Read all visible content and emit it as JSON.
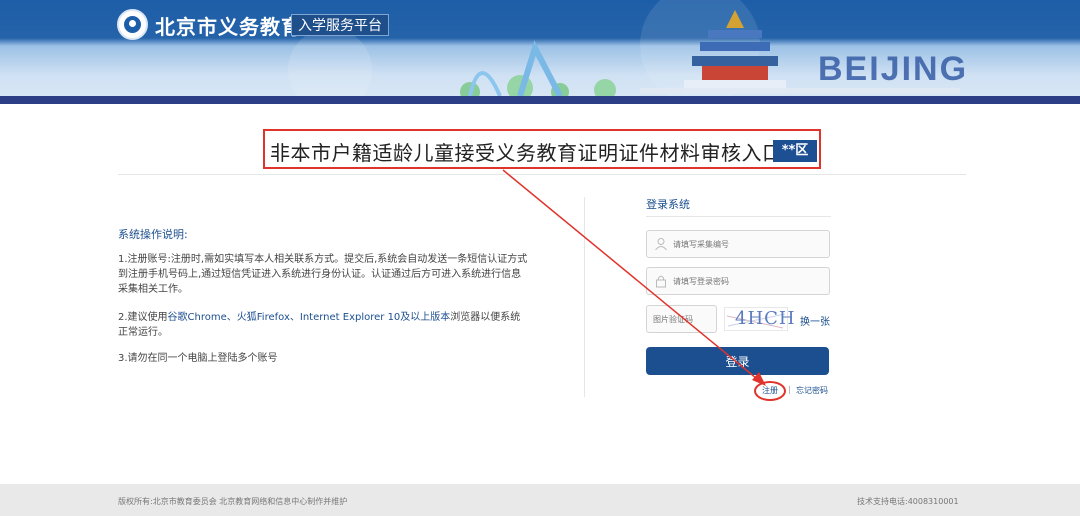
{
  "header": {
    "brand": "北京市义务教育",
    "badge": "入学服务平台",
    "banner_text": "BEIJING"
  },
  "main": {
    "title": "非本市户籍适龄儿童接受义务教育证明证件材料审核入口",
    "district_badge": "**区"
  },
  "instructions": {
    "heading": "系统操作说明:",
    "p1": "1.注册账号:注册时,需如实填写本人相关联系方式。提交后,系统会自动发送一条短信认证方式到注册手机号码上,通过短信凭证进入系统进行身份认证。认证通过后方可进入系统进行信息采集相关工作。",
    "p2_prefix": "2.建议使用",
    "p2_browsers": "谷歌Chrome、火狐Firefox、Internet Explorer 10及以上版本",
    "p2_suffix": "浏览器以便系统正常运行。",
    "p3": "3.请勿在同一个电脑上登陆多个账号"
  },
  "login": {
    "title": "登录系统",
    "username_placeholder": "请填写采集编号",
    "password_placeholder": "请填写登录密码",
    "captcha_placeholder": "图片验证码",
    "captcha_code": "4HCH",
    "refresh_label": "换一张",
    "login_button": "登录",
    "register_link": "注册",
    "separator": "|",
    "forgot_link": "忘记密码"
  },
  "footer": {
    "copyright": "版权所有:北京市教育委员会 北京教育网络和信息中心制作并维护",
    "support": "技术支持电话:4008310001"
  },
  "colors": {
    "primary": "#1c4f8f",
    "annotation_red": "#e0332b"
  }
}
